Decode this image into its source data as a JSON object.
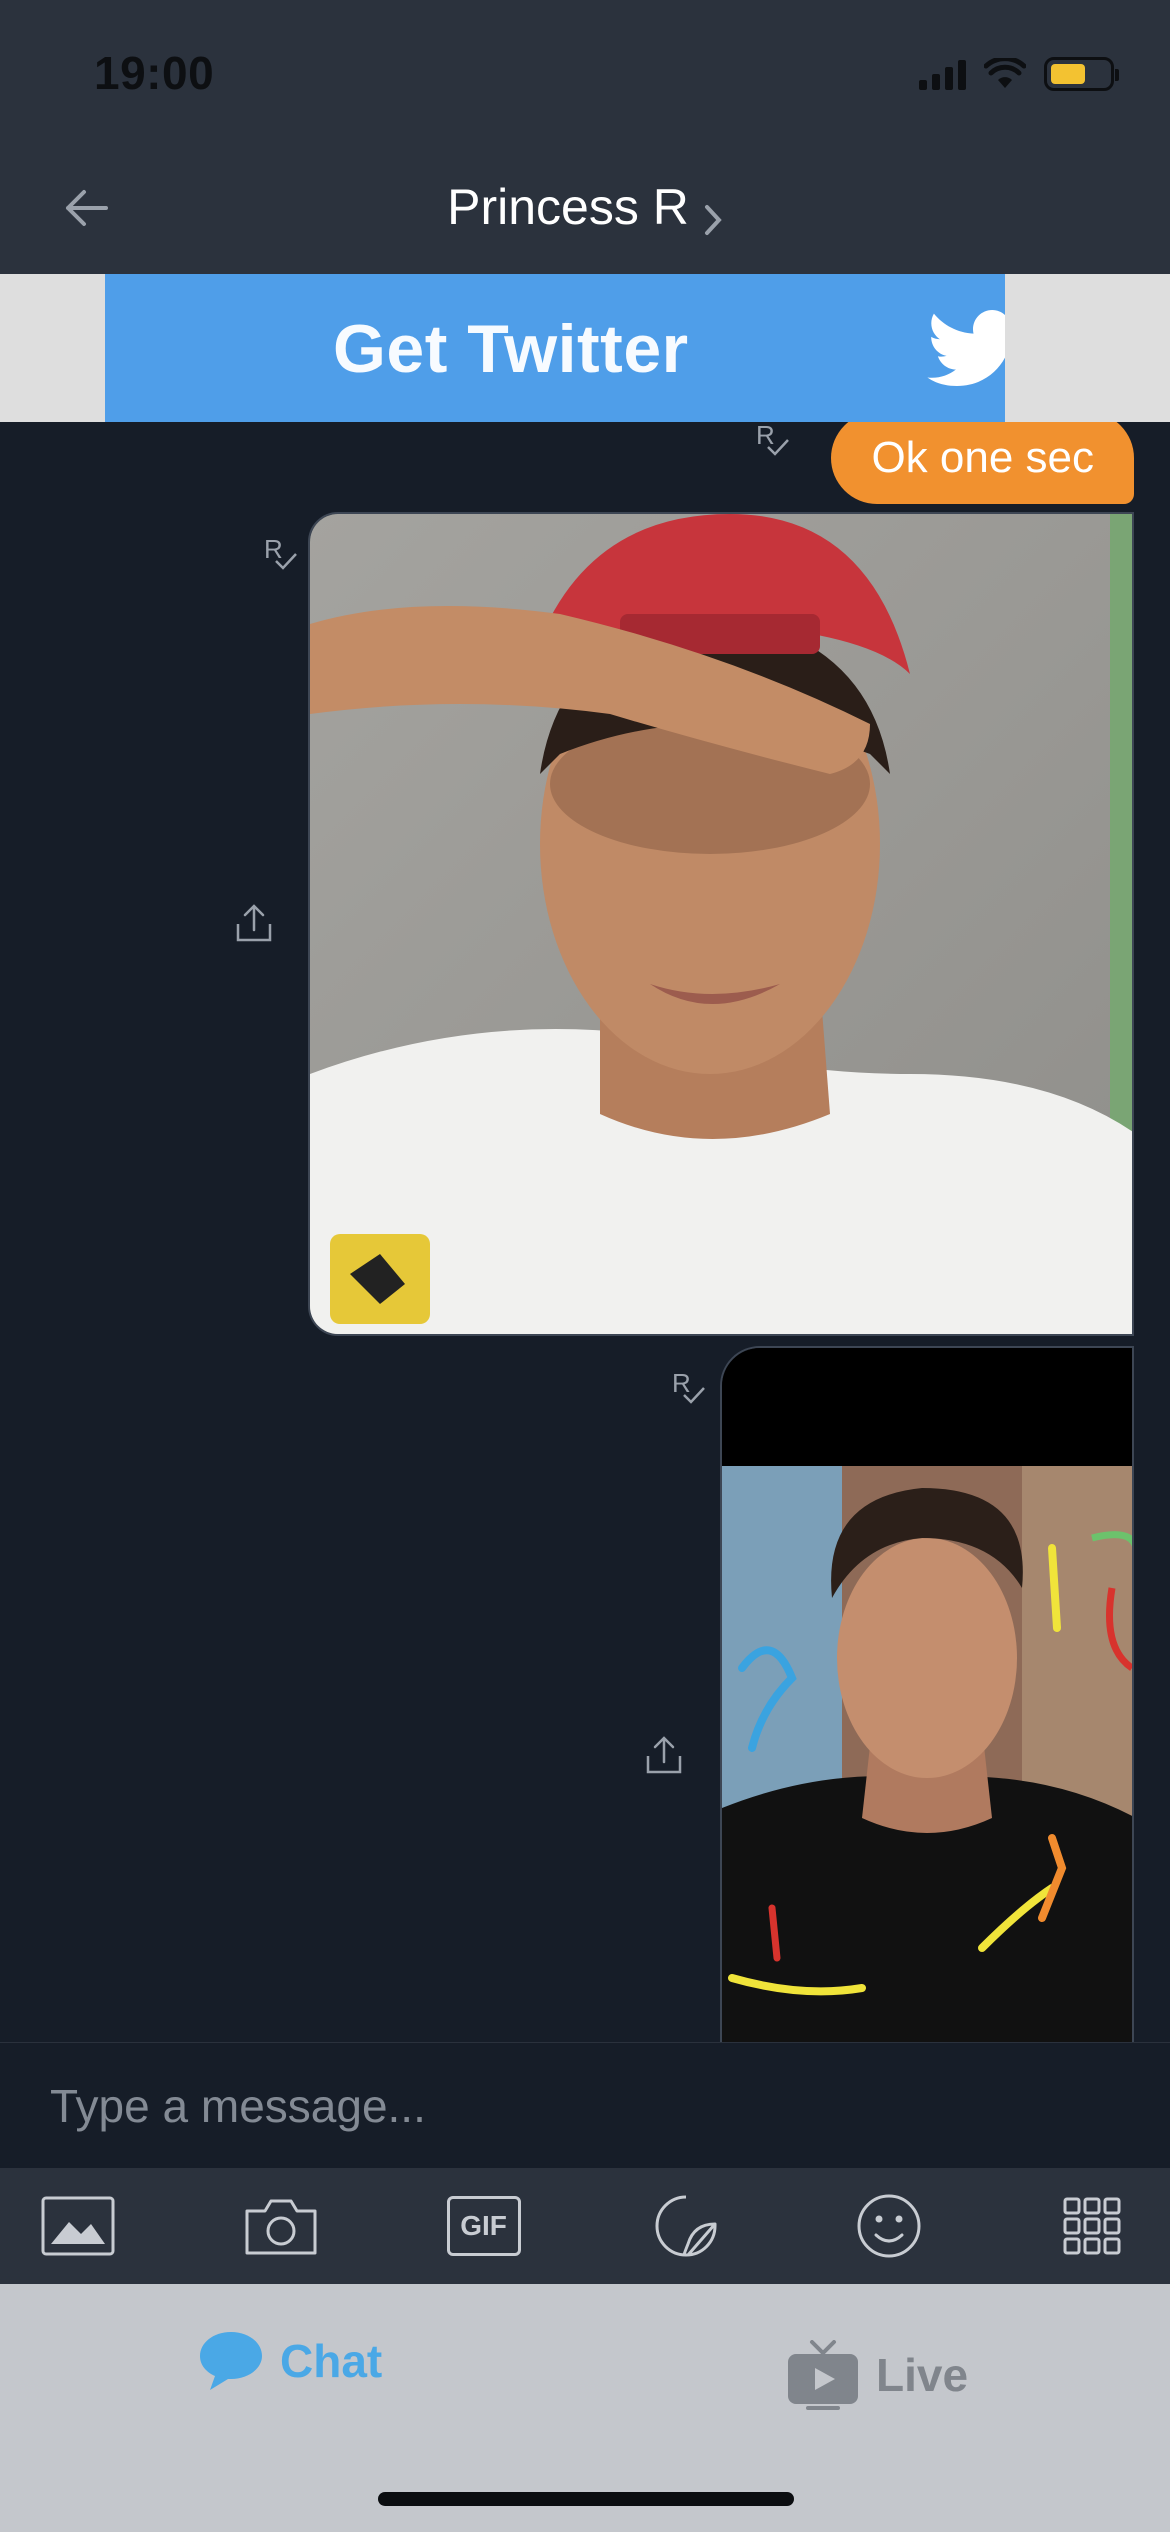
{
  "status_bar": {
    "time": "19:00",
    "battery_color": "#f3c231"
  },
  "header": {
    "title": "Princess R",
    "back_icon": "arrow-left-icon",
    "chevron_icon": "chevron-right-icon"
  },
  "ad": {
    "text": "Get Twitter",
    "icon": "twitter-bird-icon",
    "background": "#4f9ee9"
  },
  "messages": [
    {
      "type": "text",
      "text": "Ok one sec",
      "read_mark": "R",
      "bubble_color": "#f1912f"
    },
    {
      "type": "image",
      "read_mark": "R",
      "description_icon": "photo"
    },
    {
      "type": "image",
      "read_mark": "R",
      "description_icon": "photo"
    }
  ],
  "composer": {
    "placeholder": "Type a message..."
  },
  "toolbar": {
    "items": [
      "image-icon",
      "camera-icon",
      "gif-icon",
      "sticker-icon",
      "emoji-icon",
      "grid-icon"
    ],
    "gif_label": "GIF"
  },
  "tabs": {
    "chat_label": "Chat",
    "live_label": "Live",
    "active_color": "#4aa8e6"
  }
}
